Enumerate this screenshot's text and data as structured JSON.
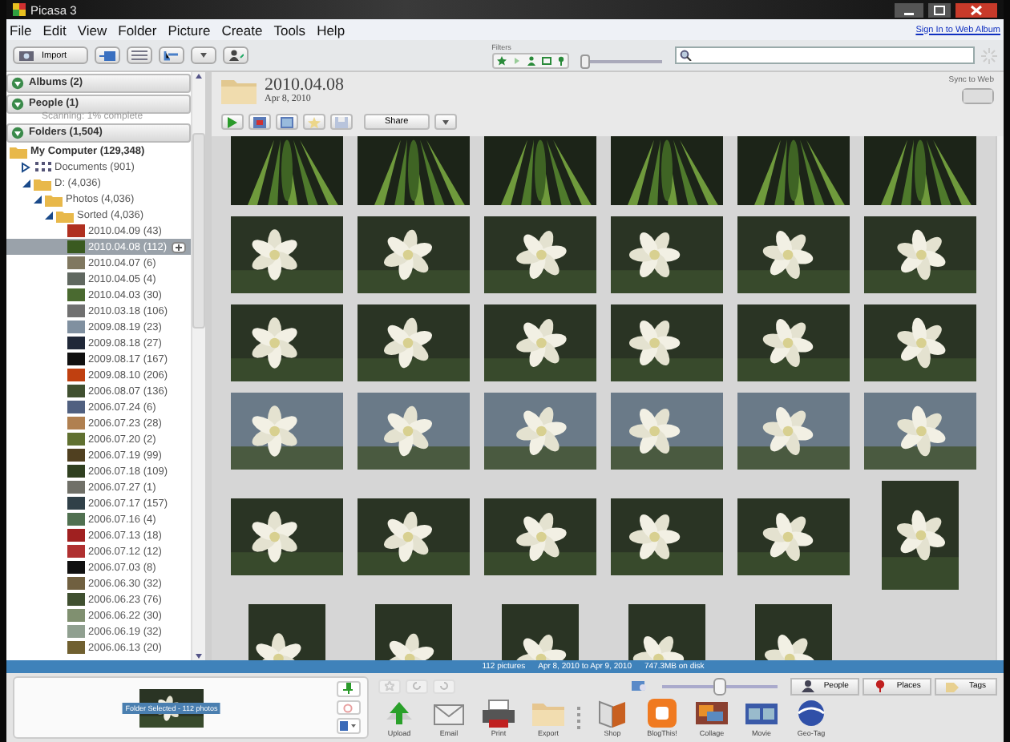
{
  "window": {
    "title": "Picasa 3"
  },
  "menu": [
    "File",
    "Edit",
    "View",
    "Folder",
    "Picture",
    "Create",
    "Tools",
    "Help"
  ],
  "sign_in_link": "Sign In to Web Album",
  "toolbar": {
    "import_label": "Import",
    "filters_label": "Filters",
    "filter_slider": {
      "level": 0.05
    }
  },
  "sidebar": {
    "sections": [
      {
        "label": "Albums (2)",
        "expanded": true
      },
      {
        "label": "People (1)",
        "expanded": true
      }
    ],
    "scan_status": "Scanning: 1% complete",
    "folders_header": {
      "label": "Folders (1,504)",
      "expanded": true
    },
    "tree": [
      {
        "label": "My Computer (129,348)",
        "kind": "computer",
        "selected": false,
        "children": [
          {
            "label": "Documents (901)",
            "kind": "documents",
            "selected": false,
            "expanded": false
          },
          {
            "label": "D: (4,036)",
            "kind": "folder",
            "selected": false,
            "expanded": true,
            "children": [
              {
                "label": "Photos (4,036)",
                "kind": "folder",
                "selected": false,
                "expanded": true,
                "children": [
                  {
                    "label": "Sorted (4,036)",
                    "kind": "folder",
                    "selected": false,
                    "expanded": true,
                    "children": [
                      {
                        "label": "2010.04.09 (43)",
                        "kind": "date",
                        "color": "#b03020",
                        "selected": false
                      },
                      {
                        "label": "2010.04.08 (112)",
                        "kind": "date",
                        "color": "#3a5a20",
                        "selected": true
                      },
                      {
                        "label": "2010.04.07 (6)",
                        "kind": "date",
                        "color": "#807860",
                        "selected": false
                      },
                      {
                        "label": "2010.04.05 (4)",
                        "kind": "date",
                        "color": "#606860",
                        "selected": false
                      },
                      {
                        "label": "2010.04.03 (30)",
                        "kind": "date",
                        "color": "#4a6a30",
                        "selected": false
                      },
                      {
                        "label": "2010.03.18 (106)",
                        "kind": "date",
                        "color": "#707070",
                        "selected": false
                      },
                      {
                        "label": "2009.08.19 (23)",
                        "kind": "date",
                        "color": "#8090a0",
                        "selected": false
                      },
                      {
                        "label": "2009.08.18 (27)",
                        "kind": "date",
                        "color": "#202838",
                        "selected": false
                      },
                      {
                        "label": "2009.08.17 (167)",
                        "kind": "date",
                        "color": "#101010",
                        "selected": false
                      },
                      {
                        "label": "2009.08.10 (206)",
                        "kind": "date",
                        "color": "#c04010",
                        "selected": false
                      },
                      {
                        "label": "2006.08.07 (136)",
                        "kind": "date",
                        "color": "#405030",
                        "selected": false
                      },
                      {
                        "label": "2006.07.24 (6)",
                        "kind": "date",
                        "color": "#506080",
                        "selected": false
                      },
                      {
                        "label": "2006.07.23 (28)",
                        "kind": "date",
                        "color": "#b08050",
                        "selected": false
                      },
                      {
                        "label": "2006.07.20 (2)",
                        "kind": "date",
                        "color": "#607030",
                        "selected": false
                      },
                      {
                        "label": "2006.07.19 (99)",
                        "kind": "date",
                        "color": "#504020",
                        "selected": false
                      },
                      {
                        "label": "2006.07.18 (109)",
                        "kind": "date",
                        "color": "#304020",
                        "selected": false
                      },
                      {
                        "label": "2006.07.27 (1)",
                        "kind": "date",
                        "color": "#707068",
                        "selected": false
                      },
                      {
                        "label": "2006.07.17 (157)",
                        "kind": "date",
                        "color": "#304048",
                        "selected": false
                      },
                      {
                        "label": "2006.07.16 (4)",
                        "kind": "date",
                        "color": "#507050",
                        "selected": false
                      },
                      {
                        "label": "2006.07.13 (18)",
                        "kind": "date",
                        "color": "#a02020",
                        "selected": false
                      },
                      {
                        "label": "2006.07.12 (12)",
                        "kind": "date",
                        "color": "#b03030",
                        "selected": false
                      },
                      {
                        "label": "2006.07.03 (8)",
                        "kind": "date",
                        "color": "#101010",
                        "selected": false
                      },
                      {
                        "label": "2006.06.30 (32)",
                        "kind": "date",
                        "color": "#706040",
                        "selected": false
                      },
                      {
                        "label": "2006.06.23 (76)",
                        "kind": "date",
                        "color": "#405030",
                        "selected": false
                      },
                      {
                        "label": "2006.06.22 (30)",
                        "kind": "date",
                        "color": "#809070",
                        "selected": false
                      },
                      {
                        "label": "2006.06.19 (32)",
                        "kind": "date",
                        "color": "#90a090",
                        "selected": false
                      },
                      {
                        "label": "2006.06.13 (20)",
                        "kind": "date",
                        "color": "#706030",
                        "selected": false
                      }
                    ]
                  }
                ]
              }
            ]
          }
        ]
      }
    ]
  },
  "folder": {
    "title": "2010.04.08",
    "date": "Apr 8, 2010",
    "sync_to_web": {
      "label": "Sync to Web",
      "on": false
    },
    "share_label": "Share"
  },
  "photo_grid": [
    [
      {
        "kind": "picture"
      },
      {
        "kind": "picture"
      },
      {
        "kind": "picture"
      },
      {
        "kind": "picture"
      },
      {
        "kind": "picture"
      },
      {
        "kind": "picture"
      }
    ],
    [
      {
        "kind": "picture"
      },
      {
        "kind": "picture"
      },
      {
        "kind": "picture"
      },
      {
        "kind": "picture"
      },
      {
        "kind": "picture"
      },
      {
        "kind": "picture"
      }
    ],
    [
      {
        "kind": "picture"
      },
      {
        "kind": "picture"
      },
      {
        "kind": "picture"
      },
      {
        "kind": "picture"
      },
      {
        "kind": "picture"
      },
      {
        "kind": "picture"
      }
    ],
    [
      {
        "kind": "picture"
      },
      {
        "kind": "picture"
      },
      {
        "kind": "picture"
      },
      {
        "kind": "picture"
      },
      {
        "kind": "picture"
      },
      {
        "kind": "picture"
      }
    ],
    [
      {
        "kind": "picture"
      },
      {
        "kind": "picture"
      },
      {
        "kind": "picture"
      },
      {
        "kind": "picture"
      },
      {
        "kind": "picture"
      },
      {
        "kind": "portrait"
      }
    ],
    [
      {
        "kind": "portrait"
      },
      {
        "kind": "portrait"
      },
      {
        "kind": "portrait"
      },
      {
        "kind": "portrait"
      },
      {
        "kind": "portrait"
      }
    ]
  ],
  "status_bar": [
    "112 pictures",
    "Apr 8, 2010 to Apr 9, 2010",
    "747.3MB on disk"
  ],
  "tray": {
    "selection_label": "Folder Selected - 112 photos",
    "actions": [
      {
        "kind": "upload",
        "label": "Upload"
      },
      {
        "kind": "email",
        "label": "Email"
      },
      {
        "kind": "print",
        "label": "Print"
      },
      {
        "kind": "export",
        "label": "Export"
      },
      {
        "kind": "shop",
        "label": "Shop"
      },
      {
        "kind": "blog",
        "label": "BlogThis!"
      },
      {
        "kind": "collage",
        "label": "Collage"
      },
      {
        "kind": "movie",
        "label": "Movie"
      },
      {
        "kind": "geotag",
        "label": "Geo-Tag"
      }
    ],
    "zoom_slider": {
      "level": 0.5
    },
    "tag_buttons": [
      {
        "kind": "people",
        "label": "People"
      },
      {
        "kind": "places",
        "label": "Places"
      },
      {
        "kind": "tags",
        "label": "Tags"
      }
    ]
  }
}
